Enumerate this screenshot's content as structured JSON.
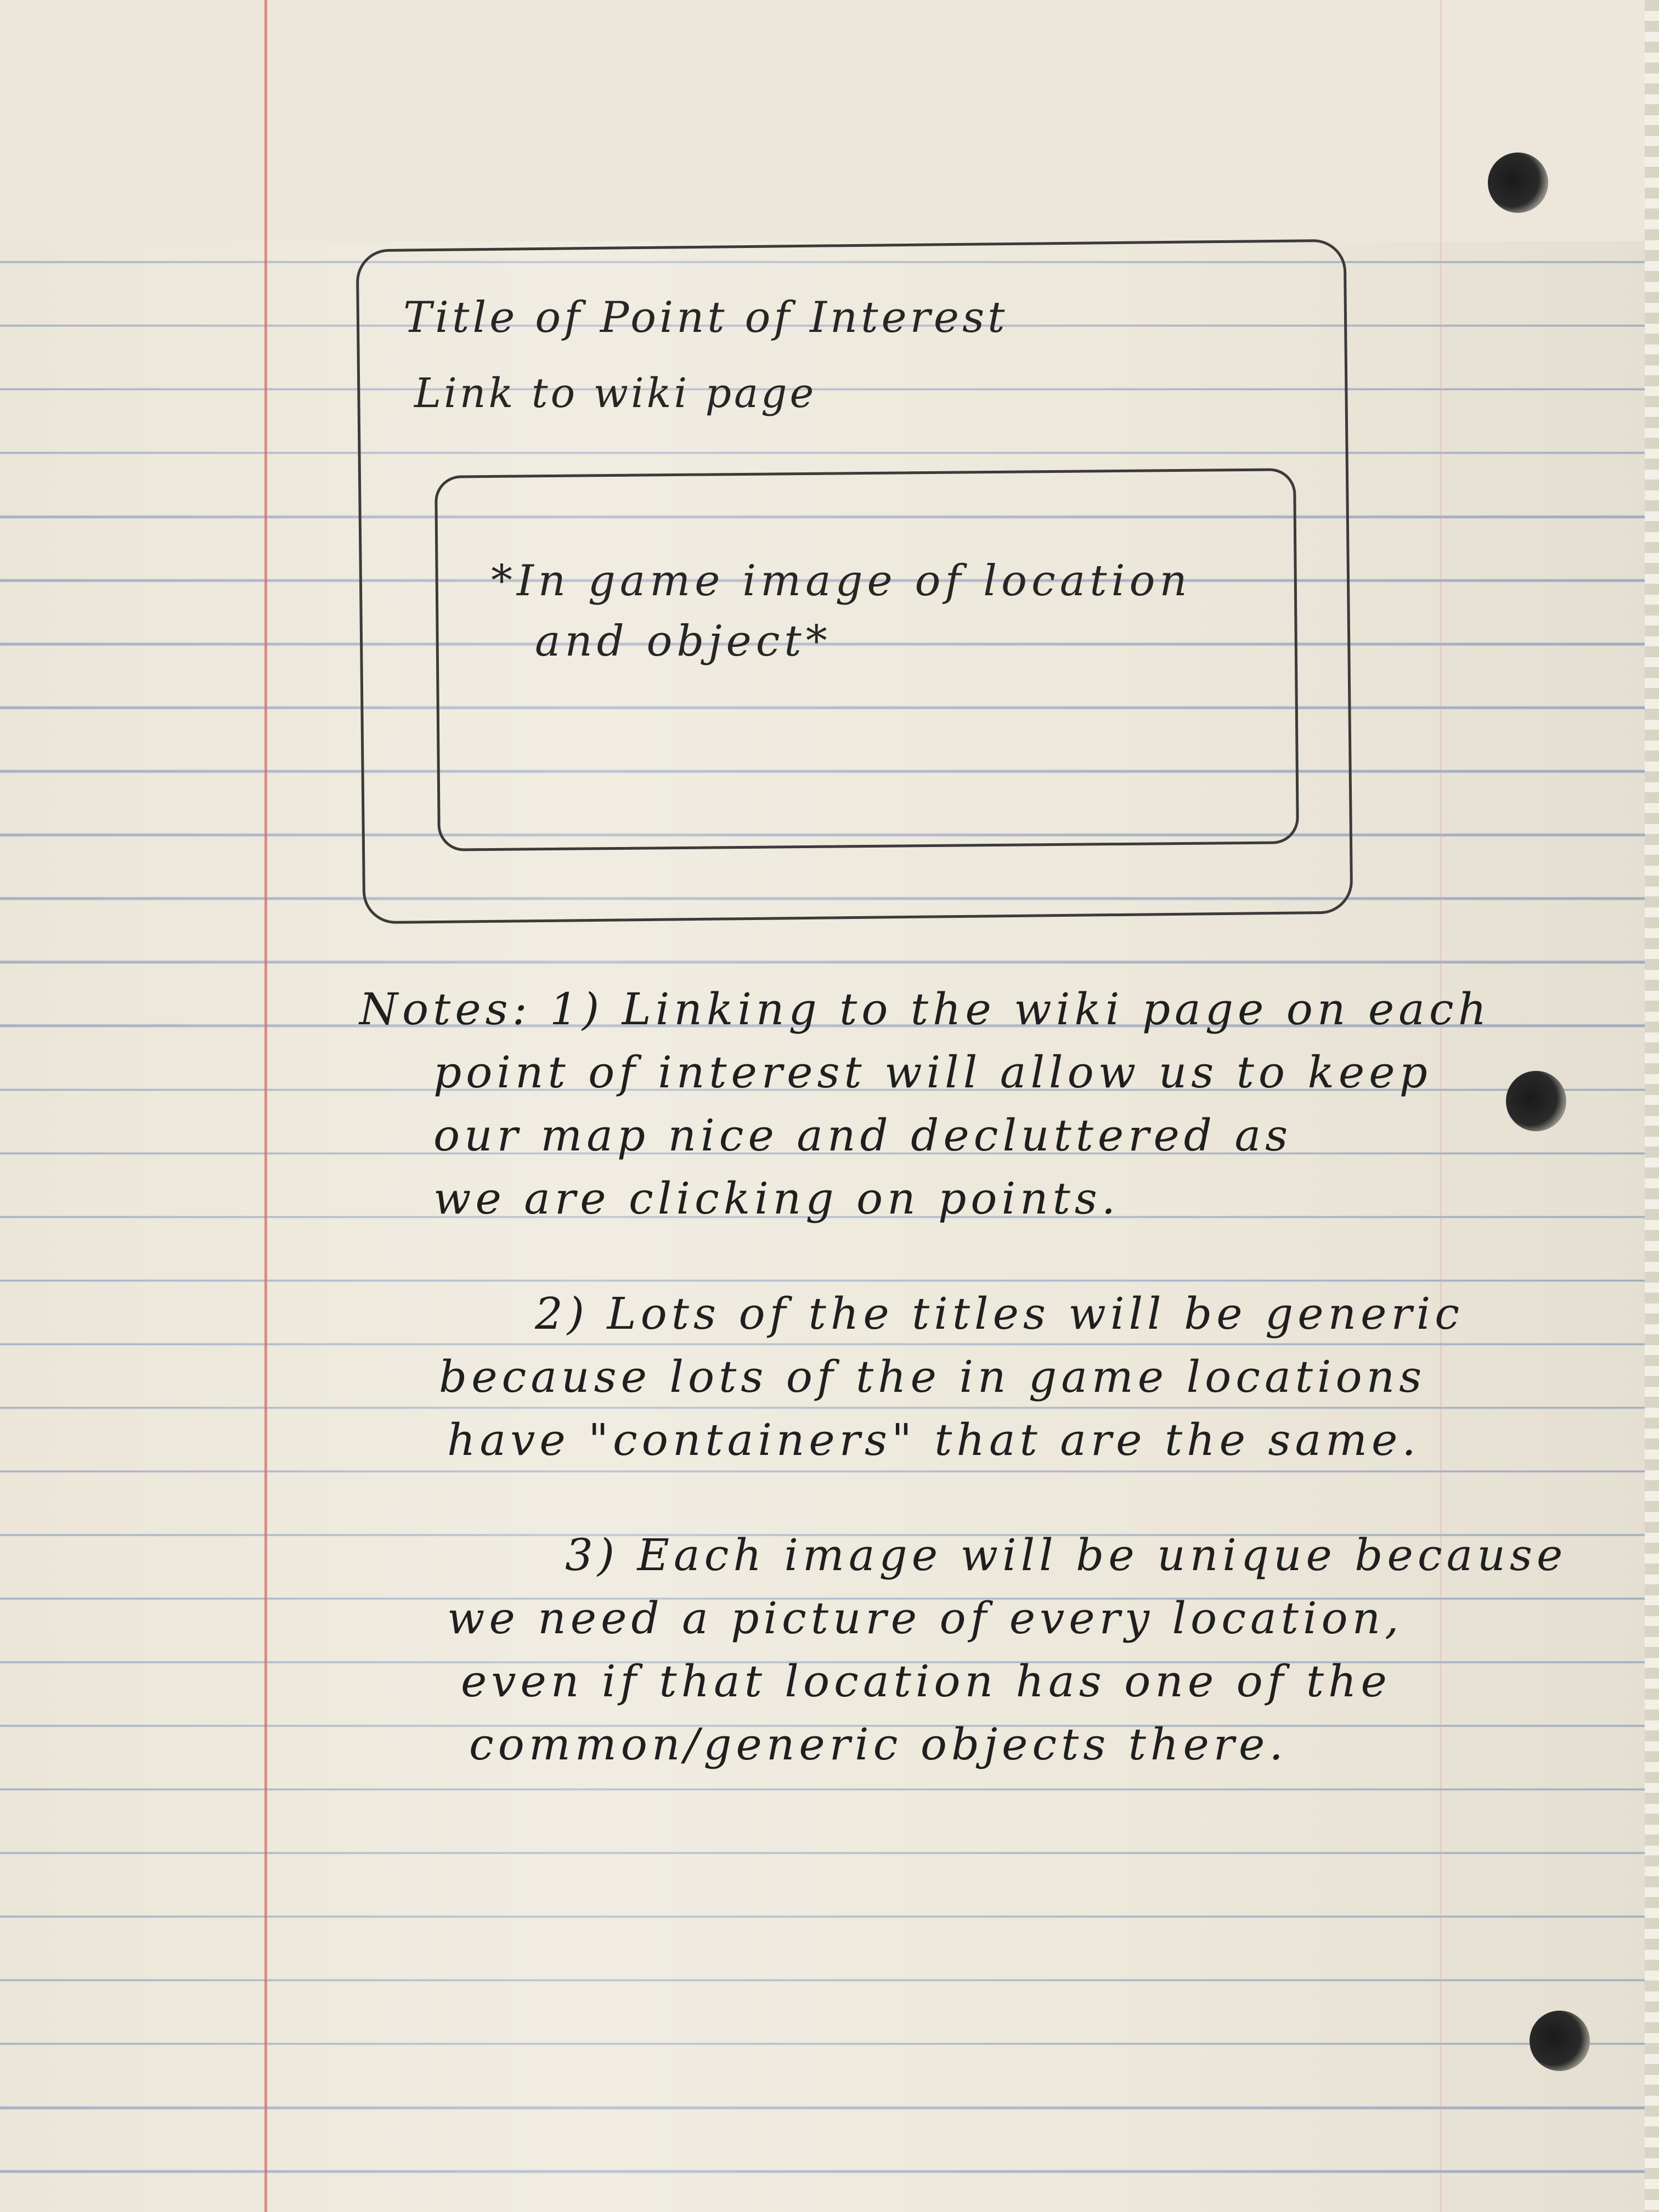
{
  "sketch": {
    "title_label": "Title of Point of Interest",
    "link_label": "Link to wiki page",
    "image_placeholder_line1": "*In game image of location",
    "image_placeholder_line2": "and object*"
  },
  "notes": {
    "lines": [
      "Notes: 1) Linking to the wiki page on each",
      "point of interest will allow us to keep",
      "our map nice and decluttered as",
      "we are clicking on points.",
      "2) Lots of the titles will be generic",
      "because lots of the in game locations",
      "have \"containers\" that are the same.",
      "3) Each image will be unique because",
      "we need a picture of every location,",
      "even if that location has one of the",
      "common/generic objects there."
    ]
  }
}
